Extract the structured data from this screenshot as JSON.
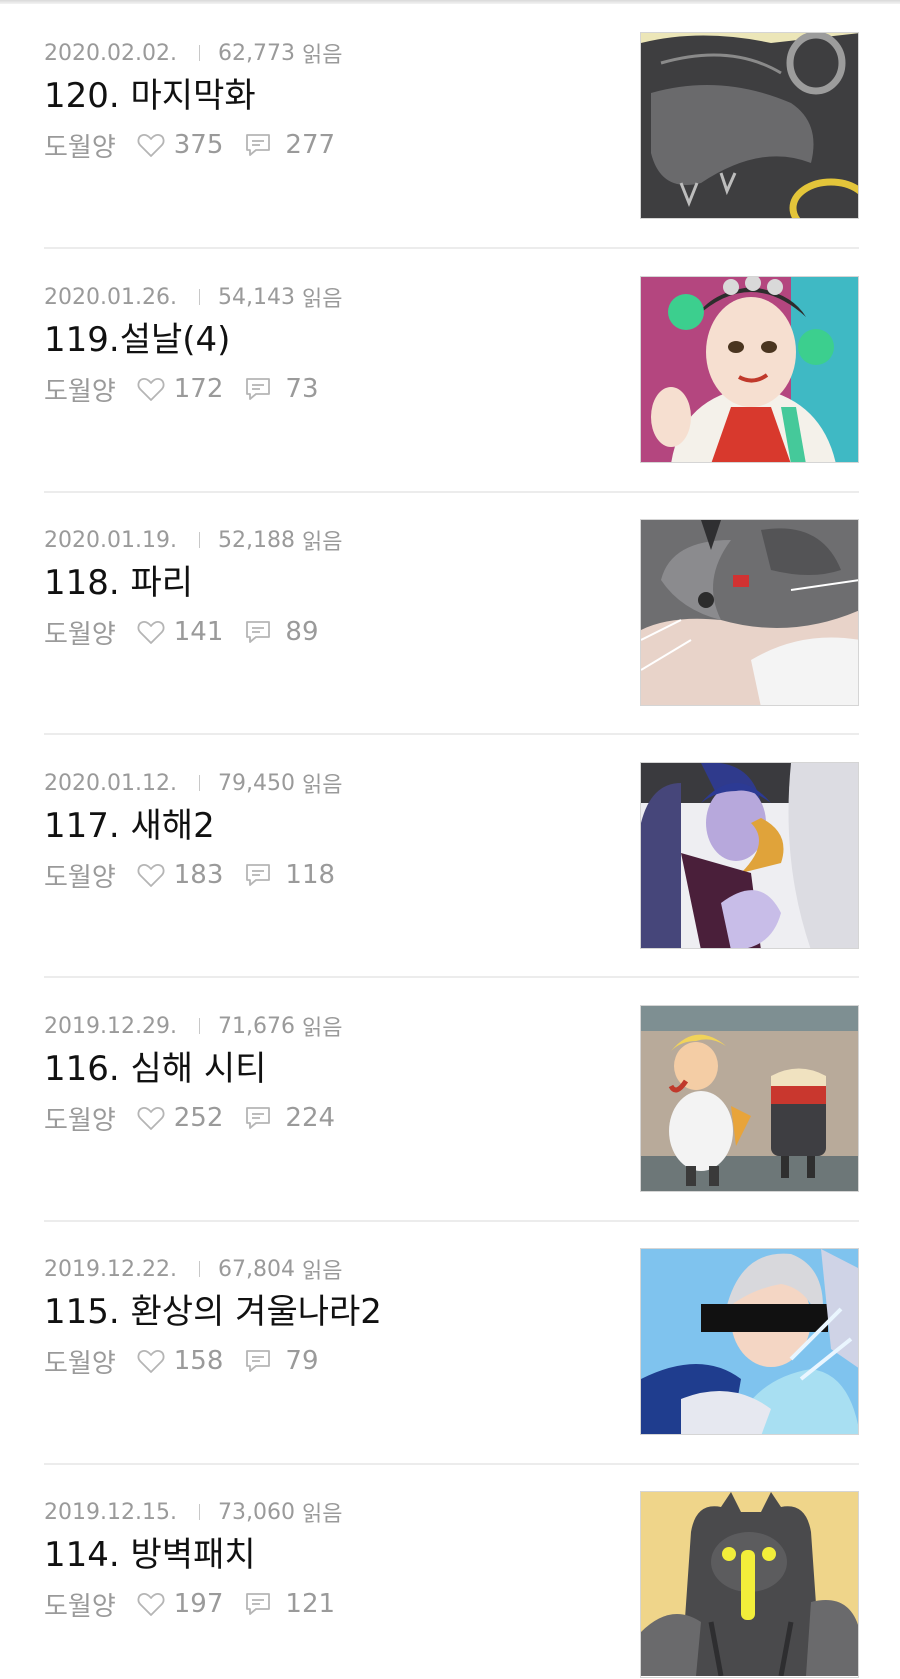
{
  "episodes": [
    {
      "date": "2020.02.02.",
      "views": "62,773",
      "title": "120. 마지막화",
      "author": "도월양",
      "likes": "375",
      "comments": "277"
    },
    {
      "date": "2020.01.26.",
      "views": "54,143",
      "title": "119.설날(4)",
      "author": "도월양",
      "likes": "172",
      "comments": "73"
    },
    {
      "date": "2020.01.19.",
      "views": "52,188",
      "title": "118. 파리",
      "author": "도월양",
      "likes": "141",
      "comments": "89"
    },
    {
      "date": "2020.01.12.",
      "views": "79,450",
      "title": "117. 새해2",
      "author": "도월양",
      "likes": "183",
      "comments": "118"
    },
    {
      "date": "2019.12.29.",
      "views": "71,676",
      "title": "116. 심해 시티",
      "author": "도월양",
      "likes": "252",
      "comments": "224"
    },
    {
      "date": "2019.12.22.",
      "views": "67,804",
      "title": "115. 환상의 겨울나라2",
      "author": "도월양",
      "likes": "158",
      "comments": "79"
    },
    {
      "date": "2019.12.15.",
      "views": "73,060",
      "title": "114. 방벽패치",
      "author": "도월양",
      "likes": "197",
      "comments": "121"
    }
  ],
  "views_unit": "읽음",
  "icons": {
    "like": "heart-icon",
    "comment": "comment-icon"
  },
  "colors": {
    "meta_text": "#9a9a9a",
    "title_text": "#111111",
    "divider": "#ececec"
  }
}
